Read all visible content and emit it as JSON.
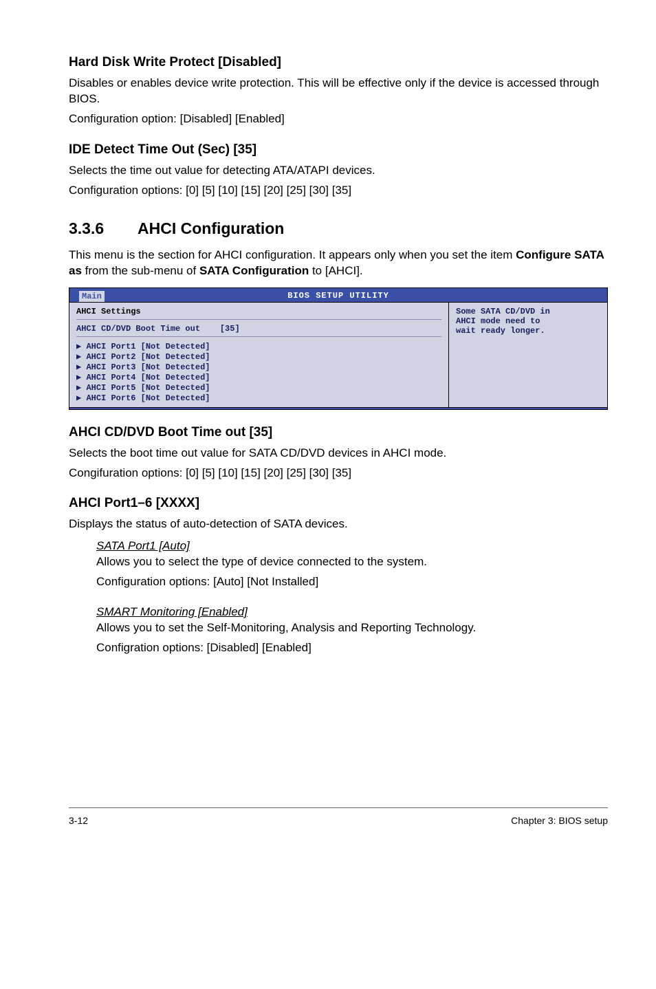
{
  "s1": {
    "title": "Hard Disk Write Protect [Disabled]",
    "p1": "Disables or enables device write protection. This will be effective only if the device is accessed through BIOS.",
    "p2": "Configuration option: [Disabled] [Enabled]"
  },
  "s2": {
    "title": "IDE Detect Time Out (Sec) [35]",
    "p1": "Selects the time out value for detecting ATA/ATAPI devices.",
    "p2": "Configuration options: [0] [5] [10] [15] [20] [25] [30] [35]"
  },
  "s3": {
    "num": "3.3.6",
    "title": "AHCI Configuration",
    "p1a": "This menu is the section for AHCI configuration. It appears only when you set the item ",
    "p1b": "Configure SATA as",
    "p1c": " from the sub-menu of ",
    "p1d": "SATA Configuration",
    "p1e": " to [AHCI]."
  },
  "bios": {
    "title": "BIOS SETUP UTILITY",
    "tab": "Main",
    "heading": "AHCI Settings",
    "opt_label": "AHCI CD/DVD Boot Time out",
    "opt_value": "[35]",
    "ports": [
      "AHCI Port1 [Not Detected]",
      "AHCI Port2 [Not Detected]",
      "AHCI Port3 [Not Detected]",
      "AHCI Port4 [Not Detected]",
      "AHCI Port5 [Not Detected]",
      "AHCI Port6 [Not Detected]"
    ],
    "help1": "Some SATA CD/DVD in",
    "help2": "AHCI mode need to",
    "help3": "wait ready longer."
  },
  "s4": {
    "title": "AHCI CD/DVD Boot Time out [35]",
    "p1": "Selects the boot time out value for SATA CD/DVD devices in AHCI mode.",
    "p2": "Congifuration options: [0] [5] [10] [15] [20] [25] [30] [35]"
  },
  "s5": {
    "title": "AHCI Port1–6 [XXXX]",
    "p1": "Displays the status of auto-detection of SATA devices.",
    "sub1": {
      "title": "SATA Port1 [Auto]",
      "p1": "Allows you to select the type of device connected to the system.",
      "p2": "Configuration options: [Auto] [Not Installed]"
    },
    "sub2": {
      "title": "SMART Monitoring [Enabled]",
      "p1": "Allows you to set the Self-Monitoring, Analysis and Reporting Technology.",
      "p2": "Configration options: [Disabled] [Enabled]"
    }
  },
  "footer": {
    "left": "3-12",
    "right": "Chapter 3: BIOS setup"
  }
}
